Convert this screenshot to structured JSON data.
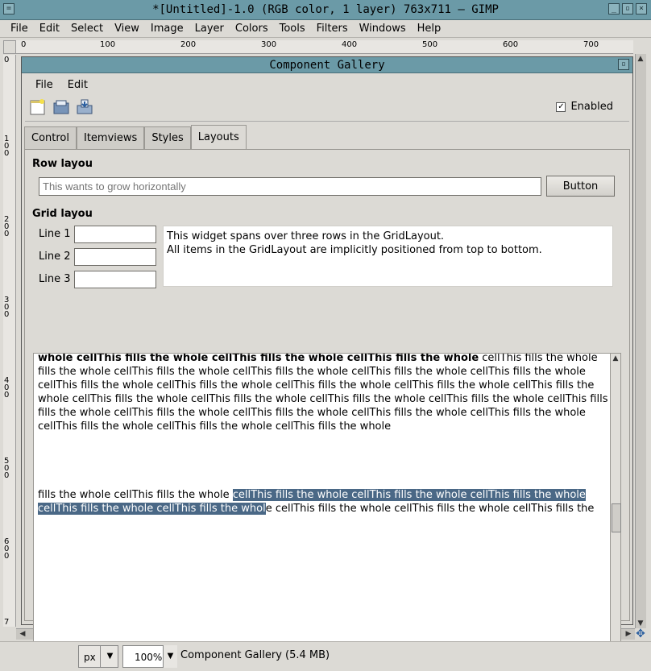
{
  "gimp": {
    "title": "*[Untitled]-1.0 (RGB color, 1 layer) 763x711  – GIMP",
    "menu": [
      "File",
      "Edit",
      "Select",
      "View",
      "Image",
      "Layer",
      "Colors",
      "Tools",
      "Filters",
      "Windows",
      "Help"
    ],
    "ruler_top_labels": [
      "0",
      "100",
      "200",
      "300",
      "400",
      "500",
      "600",
      "700"
    ],
    "ruler_left_labels": [
      "0",
      "100",
      "200",
      "300",
      "400",
      "500",
      "600",
      "7"
    ],
    "status": {
      "unit": "px",
      "zoom": "100%",
      "info": "Component Gallery (5.4 MB)"
    }
  },
  "gallery": {
    "title": "Component Gallery",
    "menu": [
      "File",
      "Edit"
    ],
    "toolbar_icons": [
      "new-icon",
      "open-icon",
      "save-icon"
    ],
    "enabled_label": "Enabled",
    "enabled_checked": "✓",
    "tabs": [
      "Control",
      "Itemviews",
      "Styles",
      "Layouts"
    ],
    "active_tab": "Layouts",
    "row_layout": {
      "label": "Row layou",
      "placeholder": "This wants to grow horizontally",
      "button": "Button"
    },
    "grid_layout": {
      "label": "Grid layou",
      "lines": [
        "Line 1",
        "Line 2",
        "Line 3"
      ],
      "span_text_1": "This widget spans over three rows in the GridLayout.",
      "span_text_2": "All items in the GridLayout are implicitly positioned from top to bottom."
    },
    "text_area": {
      "line1_bold": "whole cellThis fills the whole cellThis fills the whole cellThis fills the whole",
      "line1_rest": " cellThis fills the whole",
      "line2": "fills the whole cellThis fills the whole cellThis fills the whole cellThis fills the whole cellThis fills the whole",
      "line3": "cellThis fills the whole cellThis fills the whole cellThis fills the whole cellThis fills the whole cellThis fills the",
      "line4": "whole cellThis fills the whole cellThis fills the whole cellThis fills the whole cellThis fills the whole cellThis fills",
      "line5": "fills the whole cellThis fills the whole cellThis fills the whole cellThis fills the whole cellThis fills the whole",
      "line6": "cellThis fills the whole cellThis fills the whole cellThis fills the whole",
      "line7_pre": "fills the whole cellThis fills the whole ",
      "line7_sel": "cellThis fills the whole cellThis fills the whole cellThis fills the whole",
      "line8_sel": "cellThis fills the whole cellThis fills the whol",
      "line8_rest": "e cellThis fills the whole cellThis fills the whole cellThis fills the"
    }
  }
}
